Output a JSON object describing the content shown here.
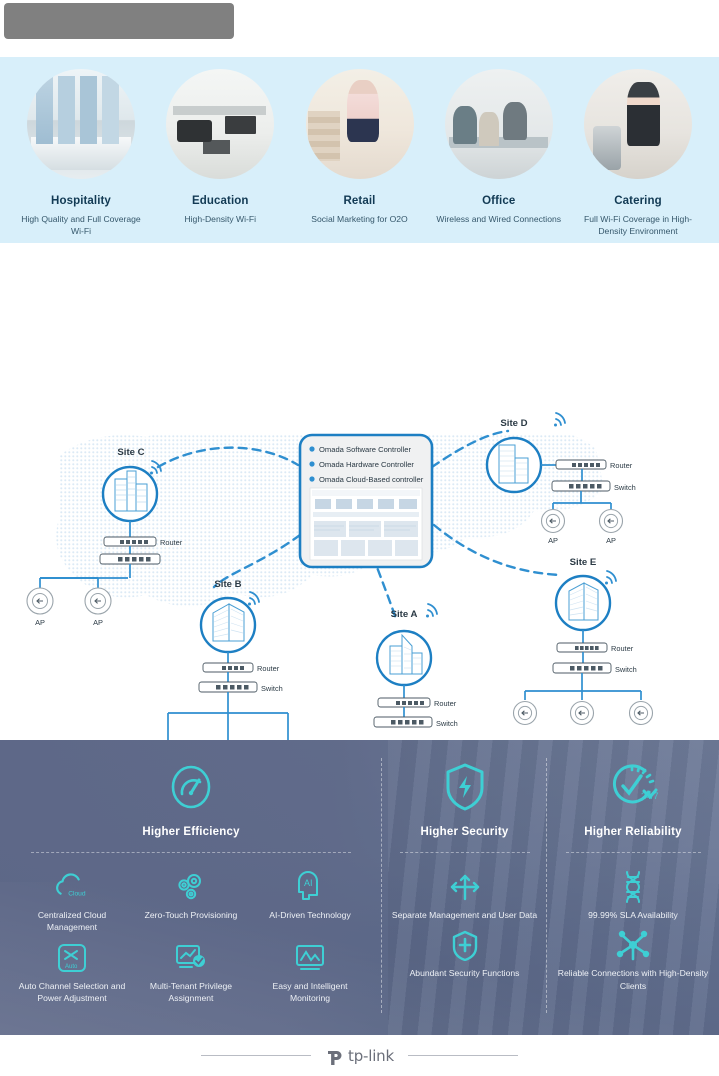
{
  "colors": {
    "scenario_band_bg": "#d8effa",
    "scenario_title": "#123a54",
    "scenario_desc": "#35576b",
    "feature_band_bg": "#5c6686",
    "feature_accent": "#3ecfd4",
    "diagram_blue": "#1d7fc3",
    "diagram_line": "#2f8fd0",
    "placeholder_gray": "#808080",
    "footer_logo_gray": "#6b6f7a"
  },
  "top_placeholder": {
    "label": ""
  },
  "scenarios": {
    "items": [
      {
        "title": "Hospitality",
        "desc": "High Quality and Full Coverage Wi-Fi",
        "photo": "hotel-lobby-photo"
      },
      {
        "title": "Education",
        "desc": "High-Density Wi-Fi",
        "photo": "classroom-photo"
      },
      {
        "title": "Retail",
        "desc": "Social Marketing for O2O",
        "photo": "retail-shopper-photo"
      },
      {
        "title": "Office",
        "desc": "Wireless and Wired Connections",
        "photo": "office-meeting-photo"
      },
      {
        "title": "Catering",
        "desc": "Full Wi-Fi Coverage in High-Density Environment",
        "photo": "barista-photo"
      }
    ]
  },
  "diagram": {
    "controller": {
      "bullets": [
        "Omada Software Controller",
        "Omada Hardware Controller",
        "Omada Cloud-Based controller"
      ],
      "screenshot_caption": "omada-dashboard-thumbnail"
    },
    "sites": [
      {
        "name": "Site C",
        "devices": [
          {
            "label": "Router",
            "type": "router"
          },
          {
            "label": "",
            "type": "switch"
          }
        ],
        "aps": [
          "AP",
          "AP"
        ]
      },
      {
        "name": "Site B",
        "devices": [
          {
            "label": "Router",
            "type": "router"
          },
          {
            "label": "Switch",
            "type": "switch"
          }
        ],
        "aps": []
      },
      {
        "name": "Site A",
        "devices": [
          {
            "label": "Router",
            "type": "router"
          },
          {
            "label": "",
            "type": "switch"
          }
        ],
        "aps": []
      },
      {
        "name": "Site D",
        "devices": [
          {
            "label": "Router",
            "type": "router"
          },
          {
            "label": "Switch",
            "type": "switch"
          }
        ],
        "aps": [
          "AP",
          "AP"
        ]
      },
      {
        "name": "Site E",
        "devices": [
          {
            "label": "Router",
            "type": "router"
          },
          {
            "label": "Switch",
            "type": "switch"
          }
        ],
        "aps": [
          "",
          "",
          ""
        ]
      }
    ]
  },
  "features": {
    "columns": [
      {
        "title": "Higher Efficiency",
        "icon": "speedometer-icon",
        "items": [
          {
            "label": "Centralized Cloud Management",
            "icon": "cloud-icon"
          },
          {
            "label": "Zero-Touch Provisioning",
            "icon": "gears-icon"
          },
          {
            "label": "AI-Driven Technology",
            "icon": "ai-head-icon"
          },
          {
            "label": "Auto Channel Selection and Power Adjustment",
            "icon": "auto-channel-icon"
          },
          {
            "label": "Multi-Tenant Privilege Assignment",
            "icon": "multi-tenant-icon"
          },
          {
            "label": "Easy and Intelligent Monitoring",
            "icon": "monitoring-icon"
          }
        ]
      },
      {
        "title": "Higher Security",
        "icon": "shield-bolt-icon",
        "items": [
          {
            "label": "Separate Management and User Data",
            "icon": "split-arrows-icon"
          },
          {
            "label": "Abundant Security Functions",
            "icon": "shield-check-icon"
          }
        ]
      },
      {
        "title": "Higher Reliability",
        "icon": "reliability-24-7-icon",
        "badge": "24/7",
        "items": [
          {
            "label": "99.99% SLA Availability",
            "icon": "dna-icon"
          },
          {
            "label": "Reliable Connections with High-Density Clients",
            "icon": "hub-nodes-icon"
          }
        ]
      }
    ]
  },
  "footer": {
    "brand": "tp-link",
    "logo": "tp-link-logo"
  }
}
